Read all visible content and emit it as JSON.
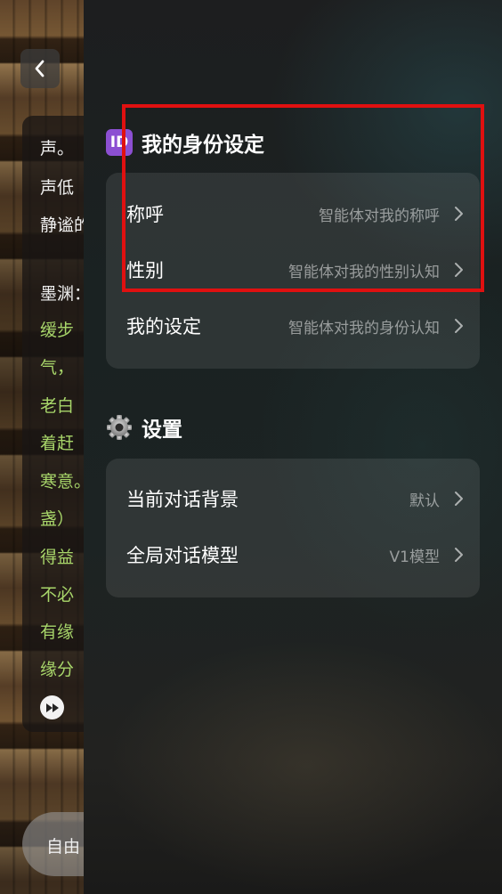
{
  "background_chat": {
    "back_icon": "chevron-left-icon",
    "lines": [
      {
        "text": "声。",
        "color": "white"
      },
      {
        "text": "声低",
        "color": "white"
      },
      {
        "text": "静谧的",
        "color": "white"
      },
      {
        "text": "墨渊：",
        "color": "white"
      },
      {
        "text": "缓步",
        "color": "green"
      },
      {
        "text": "气，",
        "color": "green"
      },
      {
        "text": "老白",
        "color": "green"
      },
      {
        "text": "着赶",
        "color": "green"
      },
      {
        "text": "寒意。",
        "color": "green"
      },
      {
        "text": "盏）",
        "color": "green"
      },
      {
        "text": "得益",
        "color": "green"
      },
      {
        "text": "不必",
        "color": "green"
      },
      {
        "text": "有缘",
        "color": "green"
      },
      {
        "text": "缘分",
        "color": "green"
      }
    ],
    "play_icon": "fast-forward-icon",
    "input_placeholder": "自由"
  },
  "drawer": {
    "identity_section": {
      "icon": "id-badge-icon",
      "icon_text": "ID",
      "title": "我的身份设定",
      "rows": [
        {
          "label": "称呼",
          "hint": "智能体对我的称呼"
        },
        {
          "label": "性别",
          "hint": "智能体对我的性别认知"
        },
        {
          "label": "我的设定",
          "hint": "智能体对我的身份认知"
        }
      ]
    },
    "settings_section": {
      "icon": "gear-icon",
      "title": "设置",
      "rows": [
        {
          "label": "当前对话背景",
          "hint": "默认"
        },
        {
          "label": "全局对话模型",
          "hint": "V1模型"
        }
      ]
    }
  },
  "colors": {
    "highlight": "#e01010",
    "id_badge": "#8c4fd2",
    "chat_green": "#a8d66a"
  }
}
